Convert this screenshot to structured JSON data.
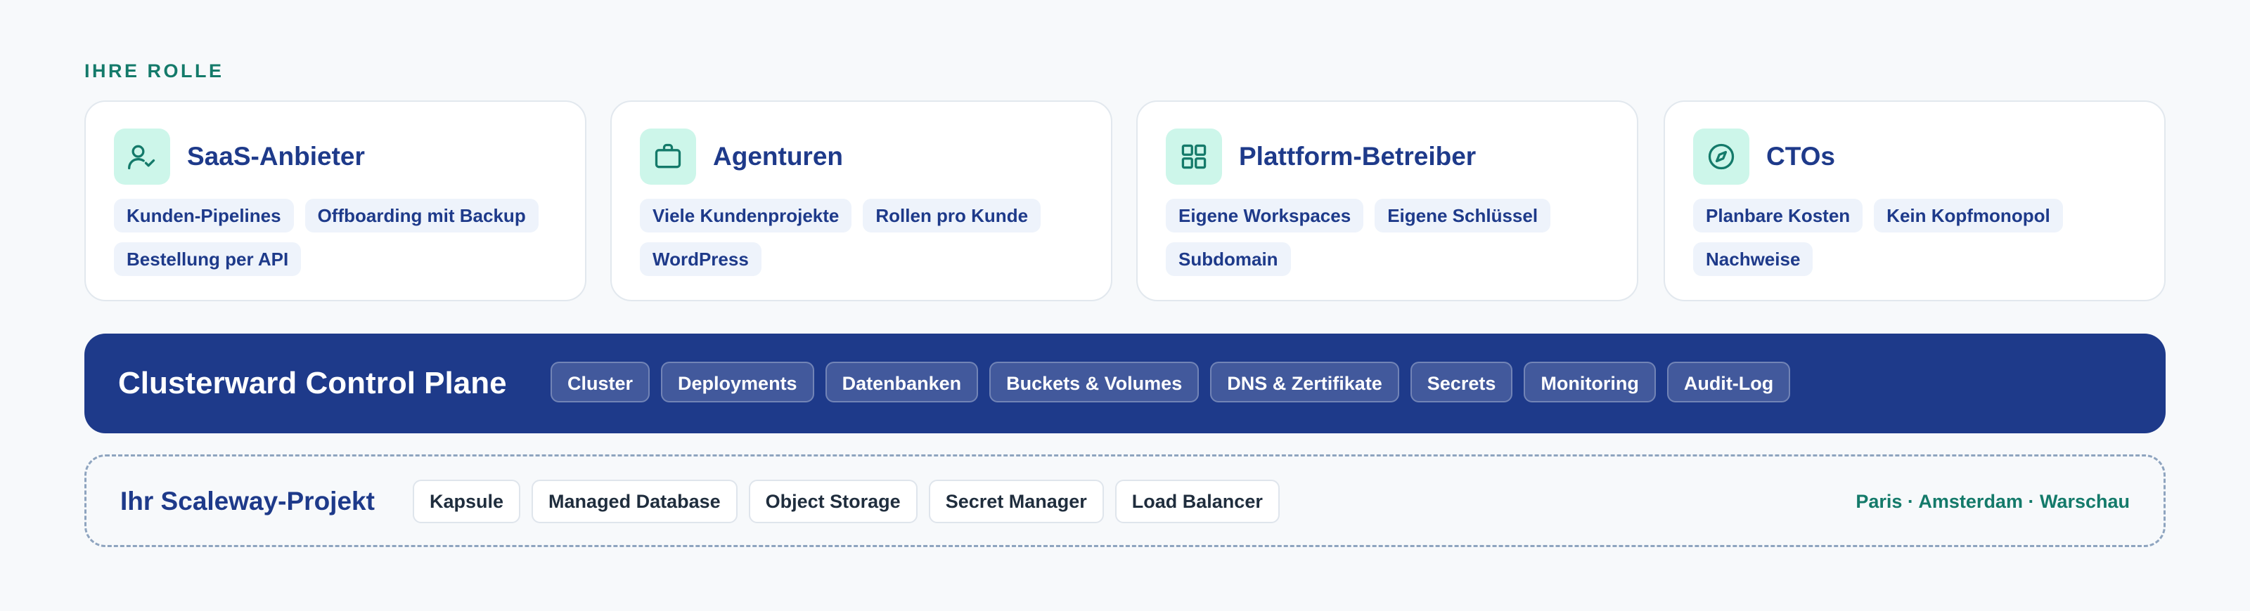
{
  "roles_section": {
    "label": "IHRE ROLLE",
    "cards": [
      {
        "title": "SaaS-Anbieter",
        "icon": "user-check-icon",
        "tags": [
          "Kunden-Pipelines",
          "Offboarding mit Backup",
          "Bestellung per API"
        ]
      },
      {
        "title": "Agenturen",
        "icon": "briefcase-icon",
        "tags": [
          "Viele Kundenprojekte",
          "Rollen pro Kunde",
          "WordPress"
        ]
      },
      {
        "title": "Plattform-Betreiber",
        "icon": "grid-icon",
        "tags": [
          "Eigene Workspaces",
          "Eigene Schlüssel",
          "Subdomain"
        ]
      },
      {
        "title": "CTOs",
        "icon": "compass-icon",
        "tags": [
          "Planbare Kosten",
          "Kein Kopfmonopol",
          "Nachweise"
        ]
      }
    ]
  },
  "control_plane": {
    "title": "Clusterward Control Plane",
    "items": [
      "Cluster",
      "Deployments",
      "Datenbanken",
      "Buckets & Volumes",
      "DNS & Zertifikate",
      "Secrets",
      "Monitoring",
      "Audit-Log"
    ]
  },
  "project": {
    "title": "Ihr Scaleway-Projekt",
    "items": [
      "Kapsule",
      "Managed Database",
      "Object Storage",
      "Secret Manager",
      "Load Balancer"
    ],
    "regions": "Paris · Amsterdam · Warschau"
  },
  "colors": {
    "accent_green": "#147a6a",
    "brand_navy": "#1e3a8a",
    "icon_bg": "#cdf6ea",
    "chip_bg": "#eef3fb"
  }
}
